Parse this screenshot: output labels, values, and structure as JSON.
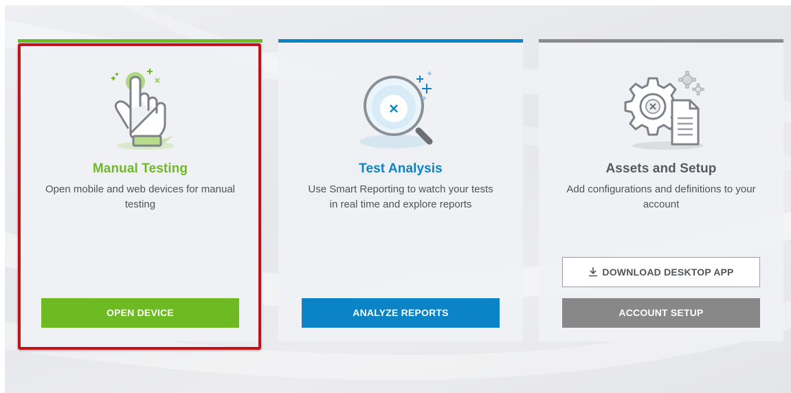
{
  "cards": [
    {
      "title": "Manual Testing",
      "description": "Open mobile and web devices for manual testing",
      "primary_button": "OPEN DEVICE",
      "icon": "hand-tap-icon",
      "accent": "#6dba22"
    },
    {
      "title": "Test Analysis",
      "description": "Use Smart Reporting to watch your tests in real time and explore reports",
      "primary_button": "ANALYZE REPORTS",
      "icon": "magnifier-icon",
      "accent": "#0a84c6"
    },
    {
      "title": "Assets and Setup",
      "description": "Add configurations and definitions to your account",
      "secondary_button": "DOWNLOAD DESKTOP APP",
      "primary_button": "ACCOUNT SETUP",
      "icon": "gear-document-icon",
      "accent": "#888888"
    }
  ],
  "highlight_color": "#c1121b"
}
